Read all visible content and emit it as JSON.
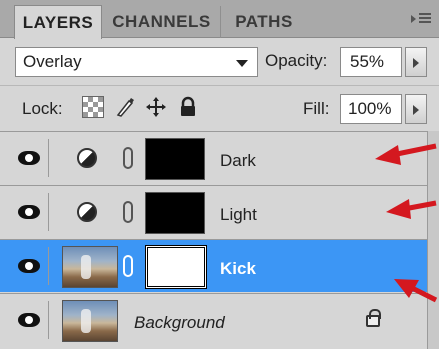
{
  "tabs": [
    {
      "label": "LAYERS",
      "active": true
    },
    {
      "label": "CHANNELS",
      "active": false
    },
    {
      "label": "PATHS",
      "active": false
    }
  ],
  "blend": {
    "mode": "Overlay",
    "opacity_label": "Opacity:",
    "opacity_value": "55%"
  },
  "lock": {
    "label": "Lock:",
    "fill_label": "Fill:",
    "fill_value": "100%"
  },
  "layers": [
    {
      "name": "Dark",
      "type": "adjustment",
      "selected": false
    },
    {
      "name": "Light",
      "type": "adjustment",
      "selected": false
    },
    {
      "name": "Kick",
      "type": "photo-with-mask",
      "selected": true
    },
    {
      "name": "Background",
      "type": "background",
      "selected": false,
      "locked": true
    }
  ],
  "colors": {
    "selection": "#3c96f5",
    "annotation_arrow": "#d4181f",
    "panel_bg": "#d6d6d6"
  }
}
